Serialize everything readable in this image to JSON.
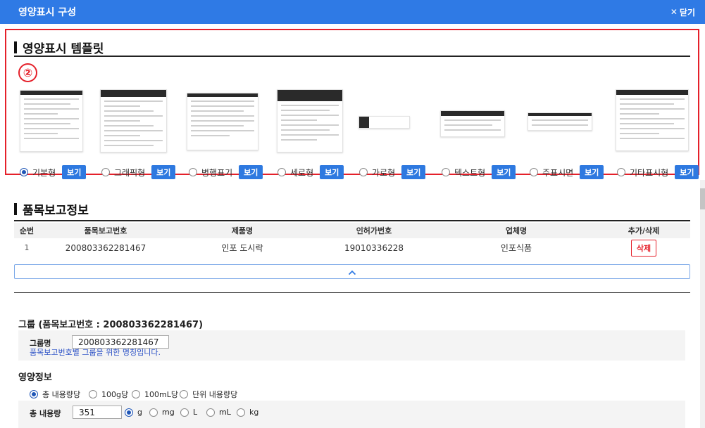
{
  "window": {
    "title": "영양표시 구성",
    "close_label": "닫기"
  },
  "templates": {
    "heading": "영양표시 템플릿",
    "marker": "②",
    "view_label": "보기",
    "options": [
      {
        "label": "기본형",
        "selected": true
      },
      {
        "label": "그래픽형",
        "selected": false
      },
      {
        "label": "병행표기",
        "selected": false
      },
      {
        "label": "세로형",
        "selected": false
      },
      {
        "label": "가로형",
        "selected": false
      },
      {
        "label": "텍스트형",
        "selected": false
      },
      {
        "label": "주표시면",
        "selected": false
      },
      {
        "label": "기타표시형",
        "selected": false
      }
    ]
  },
  "report": {
    "heading": "품목보고정보",
    "columns": [
      "순번",
      "품목보고번호",
      "제품명",
      "인허가번호",
      "업체명",
      "추가/삭제"
    ],
    "rows": [
      {
        "seq": "1",
        "report_no": "200803362281467",
        "product": "인포 도시락",
        "license_no": "19010336228",
        "company": "인포식품",
        "action": "삭제"
      }
    ]
  },
  "group": {
    "heading": "그룹 (품목보고번호 : 200803362281467)",
    "name_label": "그룹명",
    "name_value": "200803362281467",
    "hint": "품목보고번호별 그룹을 위한 명칭입니다."
  },
  "nutrition": {
    "heading": "영양정보",
    "basis_options": [
      {
        "label": "총 내용량당",
        "selected": true
      },
      {
        "label": "100g당",
        "selected": false
      },
      {
        "label": "100mL당",
        "selected": false
      },
      {
        "label": "단위 내용량당",
        "selected": false
      }
    ],
    "total_label": "총 내용량",
    "total_value": "351",
    "units": [
      {
        "label": "g",
        "selected": true
      },
      {
        "label": "mg",
        "selected": false
      },
      {
        "label": "L",
        "selected": false
      },
      {
        "label": "mL",
        "selected": false
      },
      {
        "label": "kg",
        "selected": false
      }
    ]
  },
  "colors": {
    "primary": "#2f7ae5",
    "highlight": "#e5202a",
    "view_button": "#2e79e0"
  },
  "icons": {
    "close": "close-icon",
    "collapse": "chevron-up-icon"
  }
}
